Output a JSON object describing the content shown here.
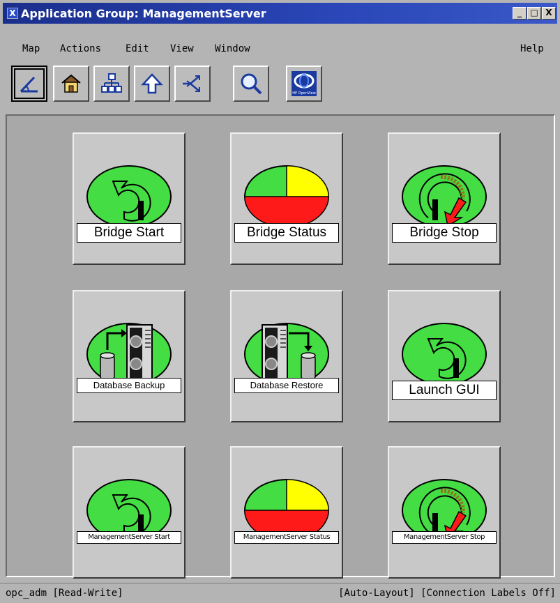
{
  "window": {
    "title": "Application Group: ManagementServer",
    "controls": {
      "minimize": "_",
      "maximize": "□",
      "close": "X"
    }
  },
  "menubar": {
    "items": [
      "Map",
      "Actions",
      "Edit",
      "View",
      "Window"
    ],
    "help": "Help"
  },
  "toolbar": {
    "icons": [
      "edit-mode-icon",
      "home-icon",
      "hierarchy-icon",
      "up-arrow-icon",
      "navigate-icon",
      "search-icon",
      "hp-openview-icon"
    ],
    "hp_logo_text": "HP OpenView"
  },
  "tiles": [
    {
      "label": "Bridge Start",
      "icon": "start-icon"
    },
    {
      "label": "Bridge Status",
      "icon": "status-pie-icon"
    },
    {
      "label": "Bridge Stop",
      "icon": "stop-icon"
    },
    {
      "label": "Database Backup",
      "icon": "database-backup-icon"
    },
    {
      "label": "Database Restore",
      "icon": "database-restore-icon"
    },
    {
      "label": "Launch GUI",
      "icon": "start-icon"
    },
    {
      "label": "ManagementServer Start",
      "icon": "start-icon"
    },
    {
      "label": "ManagementServer Status",
      "icon": "status-pie-icon"
    },
    {
      "label": "ManagementServer Stop",
      "icon": "stop-icon"
    }
  ],
  "status": {
    "left": "opc_adm [Read-Write]",
    "right": "[Auto-Layout] [Connection Labels Off]"
  },
  "colors": {
    "title_bar": "#1a2e8c",
    "icon_green": "#44dd44",
    "status_yellow": "#ffff00",
    "status_red": "#ff1a1a"
  }
}
